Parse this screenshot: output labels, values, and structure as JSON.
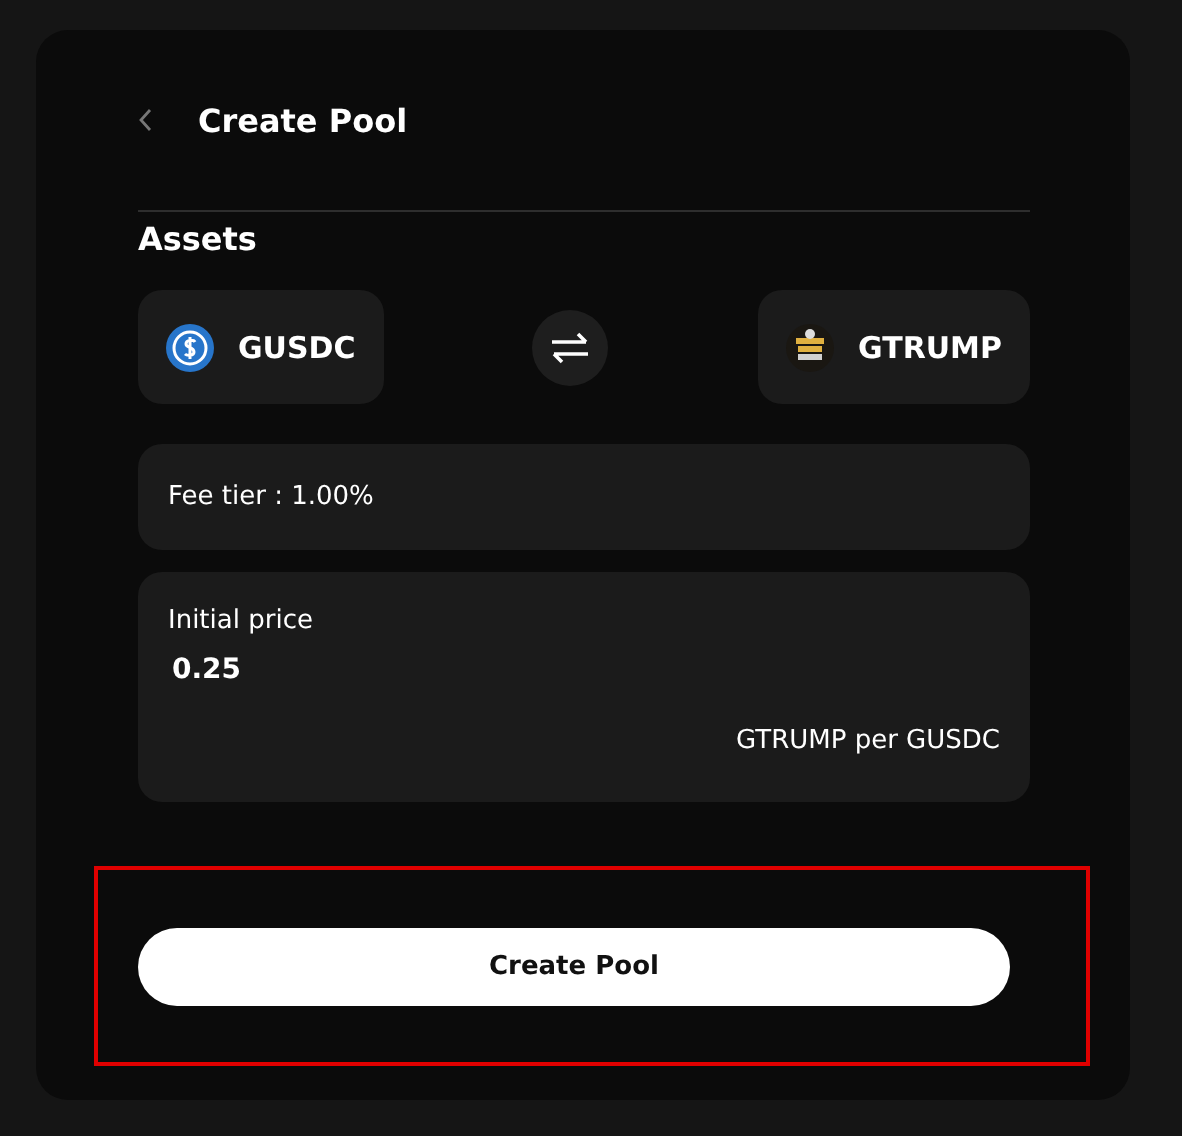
{
  "header": {
    "title": "Create Pool"
  },
  "assets": {
    "label": "Assets",
    "tokens": [
      {
        "symbol": "GUSDC",
        "kind": "usdc"
      },
      {
        "symbol": "GTRUMP",
        "kind": "meme"
      }
    ]
  },
  "fee_tier": "Fee tier : 1.00%",
  "initial_price": {
    "label": "Initial price",
    "value": "0.25",
    "unit": "GTRUMP per GUSDC"
  },
  "submit": {
    "label": "Create Pool",
    "highlighted": true
  }
}
